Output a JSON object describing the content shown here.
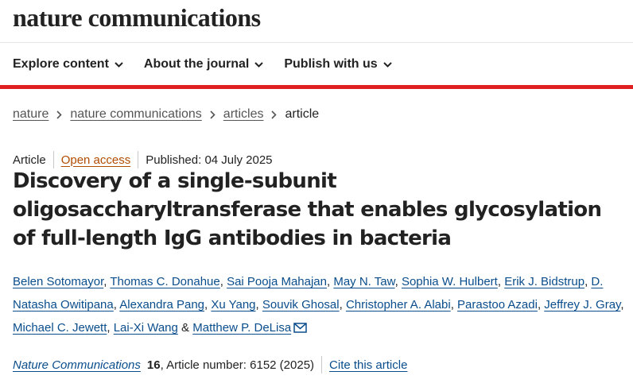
{
  "header": {
    "brand": "nature communications"
  },
  "nav": {
    "items": [
      {
        "label": "Explore content"
      },
      {
        "label": "About the journal"
      },
      {
        "label": "Publish with us"
      }
    ],
    "accent_color": "#e02020"
  },
  "breadcrumb": {
    "items": [
      "nature",
      "nature communications",
      "articles"
    ],
    "current": "article"
  },
  "article": {
    "type": "Article",
    "access": "Open access",
    "published": "Published: 04 July 2025",
    "title": "Discovery of a single-subunit oligosaccharyltransferase that enables glycosylation of full-length IgG antibodies in bacteria",
    "authors": [
      "Belen Sotomayor",
      "Thomas C. Donahue",
      "Sai Pooja Mahajan",
      "May N. Taw",
      "Sophia W. Hulbert",
      "Erik J. Bidstrup",
      "D. Natasha Owitipana",
      "Alexandra Pang",
      "Xu Yang",
      "Souvik Ghosal",
      "Christopher A. Alabi",
      "Parastoo Azadi",
      "Jeffrey J. Gray",
      "Michael C. Jewett",
      "Lai-Xi Wang",
      "Matthew P. DeLisa"
    ],
    "author_joiner": "&",
    "corresponding_icon": "mail-icon",
    "citation": {
      "journal": "Nature Communications",
      "volume": "16",
      "details": ", Article number: 6152 (2025)",
      "cite_label": "Cite this article"
    },
    "link_color": "#0a4d8c"
  }
}
